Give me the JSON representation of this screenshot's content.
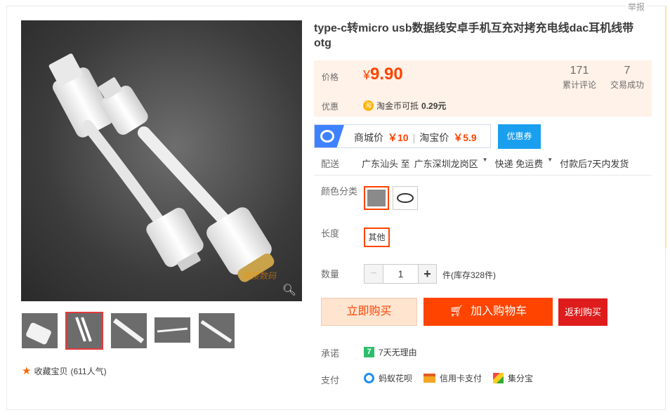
{
  "report_link": "举报",
  "product": {
    "title": "type-c转micro usb数据线安卓手机互充对拷充电线dac耳机线带otg"
  },
  "price_section": {
    "price_label": "价格",
    "currency": "¥",
    "price": "9.90",
    "reviews_count": "171",
    "reviews_label": "累计评论",
    "deals_count": "7",
    "deals_label": "交易成功",
    "discount_label": "优惠",
    "taojin_icon_text": "淘",
    "taojin_text": "淘金币可抵",
    "taojin_amount": "0.29元"
  },
  "comparison": {
    "mall_label": "商城价",
    "mall_price": "￥10",
    "taobao_label": "淘宝价",
    "taobao_price": "￥5.9",
    "coupon_button": "优惠券"
  },
  "delivery": {
    "label": "配送",
    "from": "广东汕头 至",
    "to": "广东深圳龙岗区",
    "shipping": "快递 免运费",
    "dispatch": "付款后7天内发货"
  },
  "sku": {
    "color_label": "颜色分类",
    "length_label": "长度",
    "length_option": "其他",
    "qty_label": "数量",
    "qty_minus": "−",
    "qty_value": "1",
    "qty_plus": "+",
    "stock_text": "件(库存328件)"
  },
  "buttons": {
    "buy_now": "立即购买",
    "add_to_cart": "加入购物车",
    "rebate_buy": "返利购买"
  },
  "service": {
    "promise_label": "承诺",
    "promise_icon": "7",
    "promise_text": "7天无理由",
    "payment_label": "支付",
    "payments": [
      "蚂蚁花呗",
      "信用卡支付",
      "集分宝"
    ]
  },
  "gallery": {
    "favorite_text": "收藏宝贝",
    "popularity": "(611人气)",
    "watermark": "高接数码"
  },
  "colors": {
    "accent": "#ff4400",
    "price_bg": "#fff2e8",
    "coupon_blue": "#1a9fef",
    "rebate_red": "#de1c1c"
  }
}
